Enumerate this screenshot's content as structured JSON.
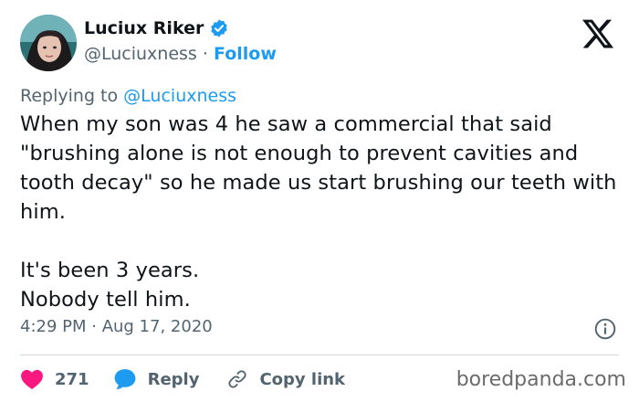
{
  "author": {
    "display_name": "Luciux Riker",
    "handle": "@Luciuxness",
    "separator": "·",
    "follow_label": "Follow"
  },
  "reply_context": {
    "prefix": "Replying to",
    "mention": "@Luciuxness"
  },
  "tweet": {
    "text": "When my son was 4 he saw a commercial that said \"brushing alone is not enough to prevent cavities and tooth decay\" so he made us start brushing our teeth with him.\n\nIt's been 3 years.\nNobody tell him.",
    "timestamp": "4:29 PM · Aug 17, 2020"
  },
  "actions": {
    "like_count": "271",
    "reply_label": "Reply",
    "copy_link_label": "Copy link"
  },
  "watermark": "boredpanda.com",
  "colors": {
    "accent": "#1d9bf0",
    "like": "#f91880",
    "muted": "#536471",
    "text": "#0f1419"
  },
  "icons": [
    "avatar-photo",
    "verified-badge-icon",
    "x-logo-icon",
    "info-icon",
    "heart-icon",
    "reply-bubble-icon",
    "link-icon"
  ]
}
